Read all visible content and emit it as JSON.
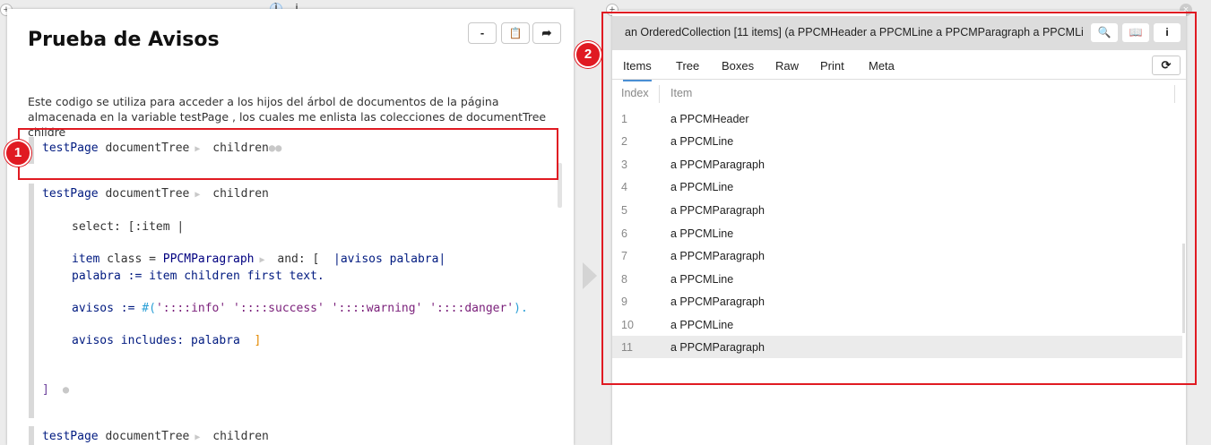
{
  "left": {
    "title": "Prueba de Avisos",
    "toolbar": {
      "minimize": "-",
      "clipboard": "📋",
      "export": "➦"
    },
    "description": "Este codigo se utiliza para acceder a los hijos del árbol de documentos de la página almacenada en la variable testPage , los cuales me enlista las colecciones de  documentTree childre",
    "block1": {
      "receiver": "testPage",
      "msg1": "documentTree",
      "msg2": "children"
    },
    "block2": {
      "receiver": "testPage",
      "msg1": "documentTree",
      "msg2": "children",
      "select": "select: [:item |",
      "item_kw": "item",
      "class_kw": "class =",
      "class_name": "PPCMParagraph",
      "and_kw": "and: [",
      "block_args": "|avisos palabra|",
      "palabra_line": "palabra := item children first text.",
      "avisos_lhs": "avisos := ",
      "s1": "'::::info'",
      "s2": "'::::success'",
      "s3": "'::::warning'",
      "s4": "'::::danger'",
      "includes": "avisos includes: palabra",
      "close_inner": "]",
      "close_outer": "]"
    },
    "block3": {
      "receiver": "testPage",
      "msg1": "documentTree",
      "msg2": "children"
    }
  },
  "annotations": {
    "badge1": "1",
    "badge2": "2"
  },
  "right": {
    "title": "an OrderedCollection [11 items] (a PPCMHeader a PPCMLine a PPCMParagraph a PPCMLi",
    "buttons": {
      "search": "🔍",
      "book": "📖",
      "info": "i"
    },
    "tabs": [
      "Items",
      "Tree",
      "Boxes",
      "Raw",
      "Print",
      "Meta"
    ],
    "refresh": "⟳",
    "columns": {
      "index": "Index",
      "item": "Item"
    },
    "rows": [
      {
        "index": "1",
        "item": "a PPCMHeader"
      },
      {
        "index": "2",
        "item": "a PPCMLine"
      },
      {
        "index": "3",
        "item": "a PPCMParagraph"
      },
      {
        "index": "4",
        "item": "a PPCMLine"
      },
      {
        "index": "5",
        "item": "a PPCMParagraph"
      },
      {
        "index": "6",
        "item": "a PPCMLine"
      },
      {
        "index": "7",
        "item": "a PPCMParagraph"
      },
      {
        "index": "8",
        "item": "a PPCMLine"
      },
      {
        "index": "9",
        "item": "a PPCMParagraph"
      },
      {
        "index": "10",
        "item": "a PPCMLine"
      },
      {
        "index": "11",
        "item": "a PPCMParagraph"
      }
    ]
  },
  "window": {
    "add": "+",
    "close": "×",
    "pin": "i"
  }
}
